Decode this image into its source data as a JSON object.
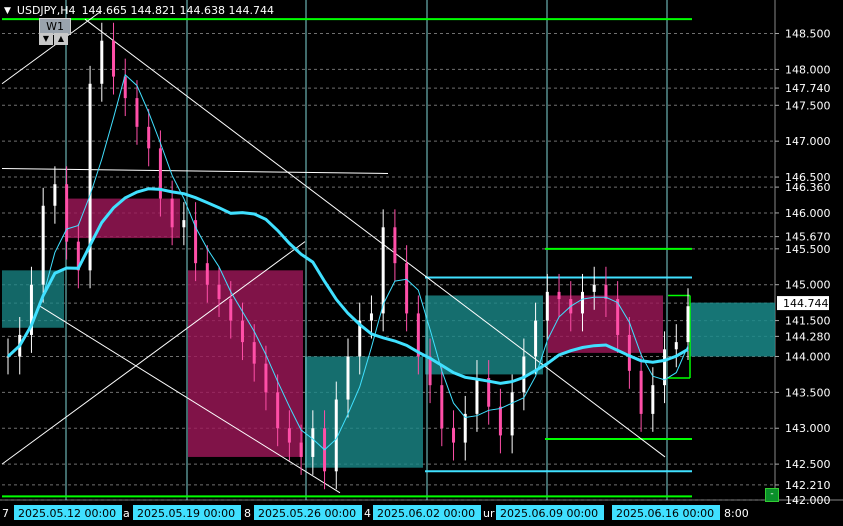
{
  "header": {
    "menu_icon": "triangle-down-icon",
    "symbol": "USDJPY,H4",
    "ohlc": "144.665 144.821 144.638 144.744"
  },
  "timeframe": {
    "label": "W1",
    "down_icon": "down-triangle-icon",
    "up_icon": "up-triangle-icon"
  },
  "price_axis": {
    "min": 142.0,
    "max": 148.8,
    "labels": [
      {
        "value": 148.5,
        "text": "148.500",
        "style": "normal"
      },
      {
        "value": 148.0,
        "text": "148.000",
        "style": "normal"
      },
      {
        "value": 147.74,
        "text": "147.740",
        "style": "normal"
      },
      {
        "value": 147.5,
        "text": "147.500",
        "style": "normal"
      },
      {
        "value": 147.0,
        "text": "147.000",
        "style": "normal"
      },
      {
        "value": 146.5,
        "text": "146.500",
        "style": "normal"
      },
      {
        "value": 146.36,
        "text": "146.360",
        "style": "normal"
      },
      {
        "value": 146.0,
        "text": "146.000",
        "style": "normal"
      },
      {
        "value": 145.67,
        "text": "145.670",
        "style": "normal"
      },
      {
        "value": 145.5,
        "text": "145.500",
        "style": "normal"
      },
      {
        "value": 145.0,
        "text": "145.000",
        "style": "normal"
      },
      {
        "value": 144.744,
        "text": "144.744",
        "style": "current"
      },
      {
        "value": 144.5,
        "text": "141.500",
        "style": "normal"
      },
      {
        "value": 144.28,
        "text": "144.280",
        "style": "normal"
      },
      {
        "value": 144.0,
        "text": "144.000",
        "style": "normal"
      },
      {
        "value": 143.5,
        "text": "143.500",
        "style": "normal"
      },
      {
        "value": 143.0,
        "text": "143.000",
        "style": "normal"
      },
      {
        "value": 142.5,
        "text": "142.500",
        "style": "normal"
      },
      {
        "value": 142.21,
        "text": "142.210",
        "style": "normal"
      },
      {
        "value": 142.0,
        "text": "142.000",
        "style": "normal"
      }
    ]
  },
  "time_axis": {
    "labels": [
      {
        "text": "2025.05.12 00:00",
        "x_index": 12
      },
      {
        "text": "2025.05.19 00:00",
        "x_index": 48
      },
      {
        "text": "2025.05.26 00:00",
        "x_index": 84
      },
      {
        "text": "2025.06.02 00:00",
        "x_index": 120
      },
      {
        "text": "2025.06.09 00:00",
        "x_index": 156
      },
      {
        "text": "2025.06.16 00:00",
        "x_index": 190
      }
    ],
    "partial_labels": [
      "7",
      "a",
      "8",
      "4",
      "ur",
      "8:00"
    ]
  },
  "chart_data": {
    "type": "candlestick",
    "symbol": "USDJPY",
    "timeframe": "H4",
    "last_price": 144.744,
    "horizontal_levels": [
      {
        "value": 148.7,
        "color": "#00ff00"
      },
      {
        "value": 145.5,
        "color": "#00ff00"
      },
      {
        "value": 145.1,
        "color": "#40e0ff"
      },
      {
        "value": 142.85,
        "color": "#00ff00"
      },
      {
        "value": 142.4,
        "color": "#40e0ff"
      },
      {
        "value": 142.05,
        "color": "#00ff00"
      }
    ],
    "candles_close_path": [
      144.0,
      144.3,
      145.0,
      146.1,
      146.4,
      145.6,
      145.2,
      147.8,
      148.4,
      147.9,
      147.6,
      147.2,
      146.9,
      146.2,
      145.8,
      145.9,
      145.3,
      145.0,
      144.8,
      144.5,
      144.2,
      143.9,
      143.5,
      143.0,
      142.8,
      142.6,
      143.0,
      142.4,
      143.4,
      144.0,
      144.5,
      144.6,
      145.8,
      145.3,
      144.6,
      144.0,
      143.6,
      143.0,
      142.8,
      143.2,
      143.7,
      143.3,
      142.9,
      143.5,
      144.0,
      144.5,
      144.9,
      144.8,
      144.6,
      144.9,
      145.0,
      144.8,
      144.3,
      143.8,
      143.2,
      143.6,
      144.1,
      144.2,
      144.7
    ]
  },
  "colors": {
    "background": "#000000",
    "bull_candle": "#ffffff",
    "bear_candle": "#ff4fa8",
    "ma_thick": "#40e0ff",
    "ma_thin": "#40e0ff",
    "zone_pink": "#a0185a",
    "zone_teal": "#1a8a8a",
    "vertical_line": "#7fd6d6",
    "grid": "#707070",
    "price_tag_bg": "#ffffff"
  },
  "corner_button": "-"
}
